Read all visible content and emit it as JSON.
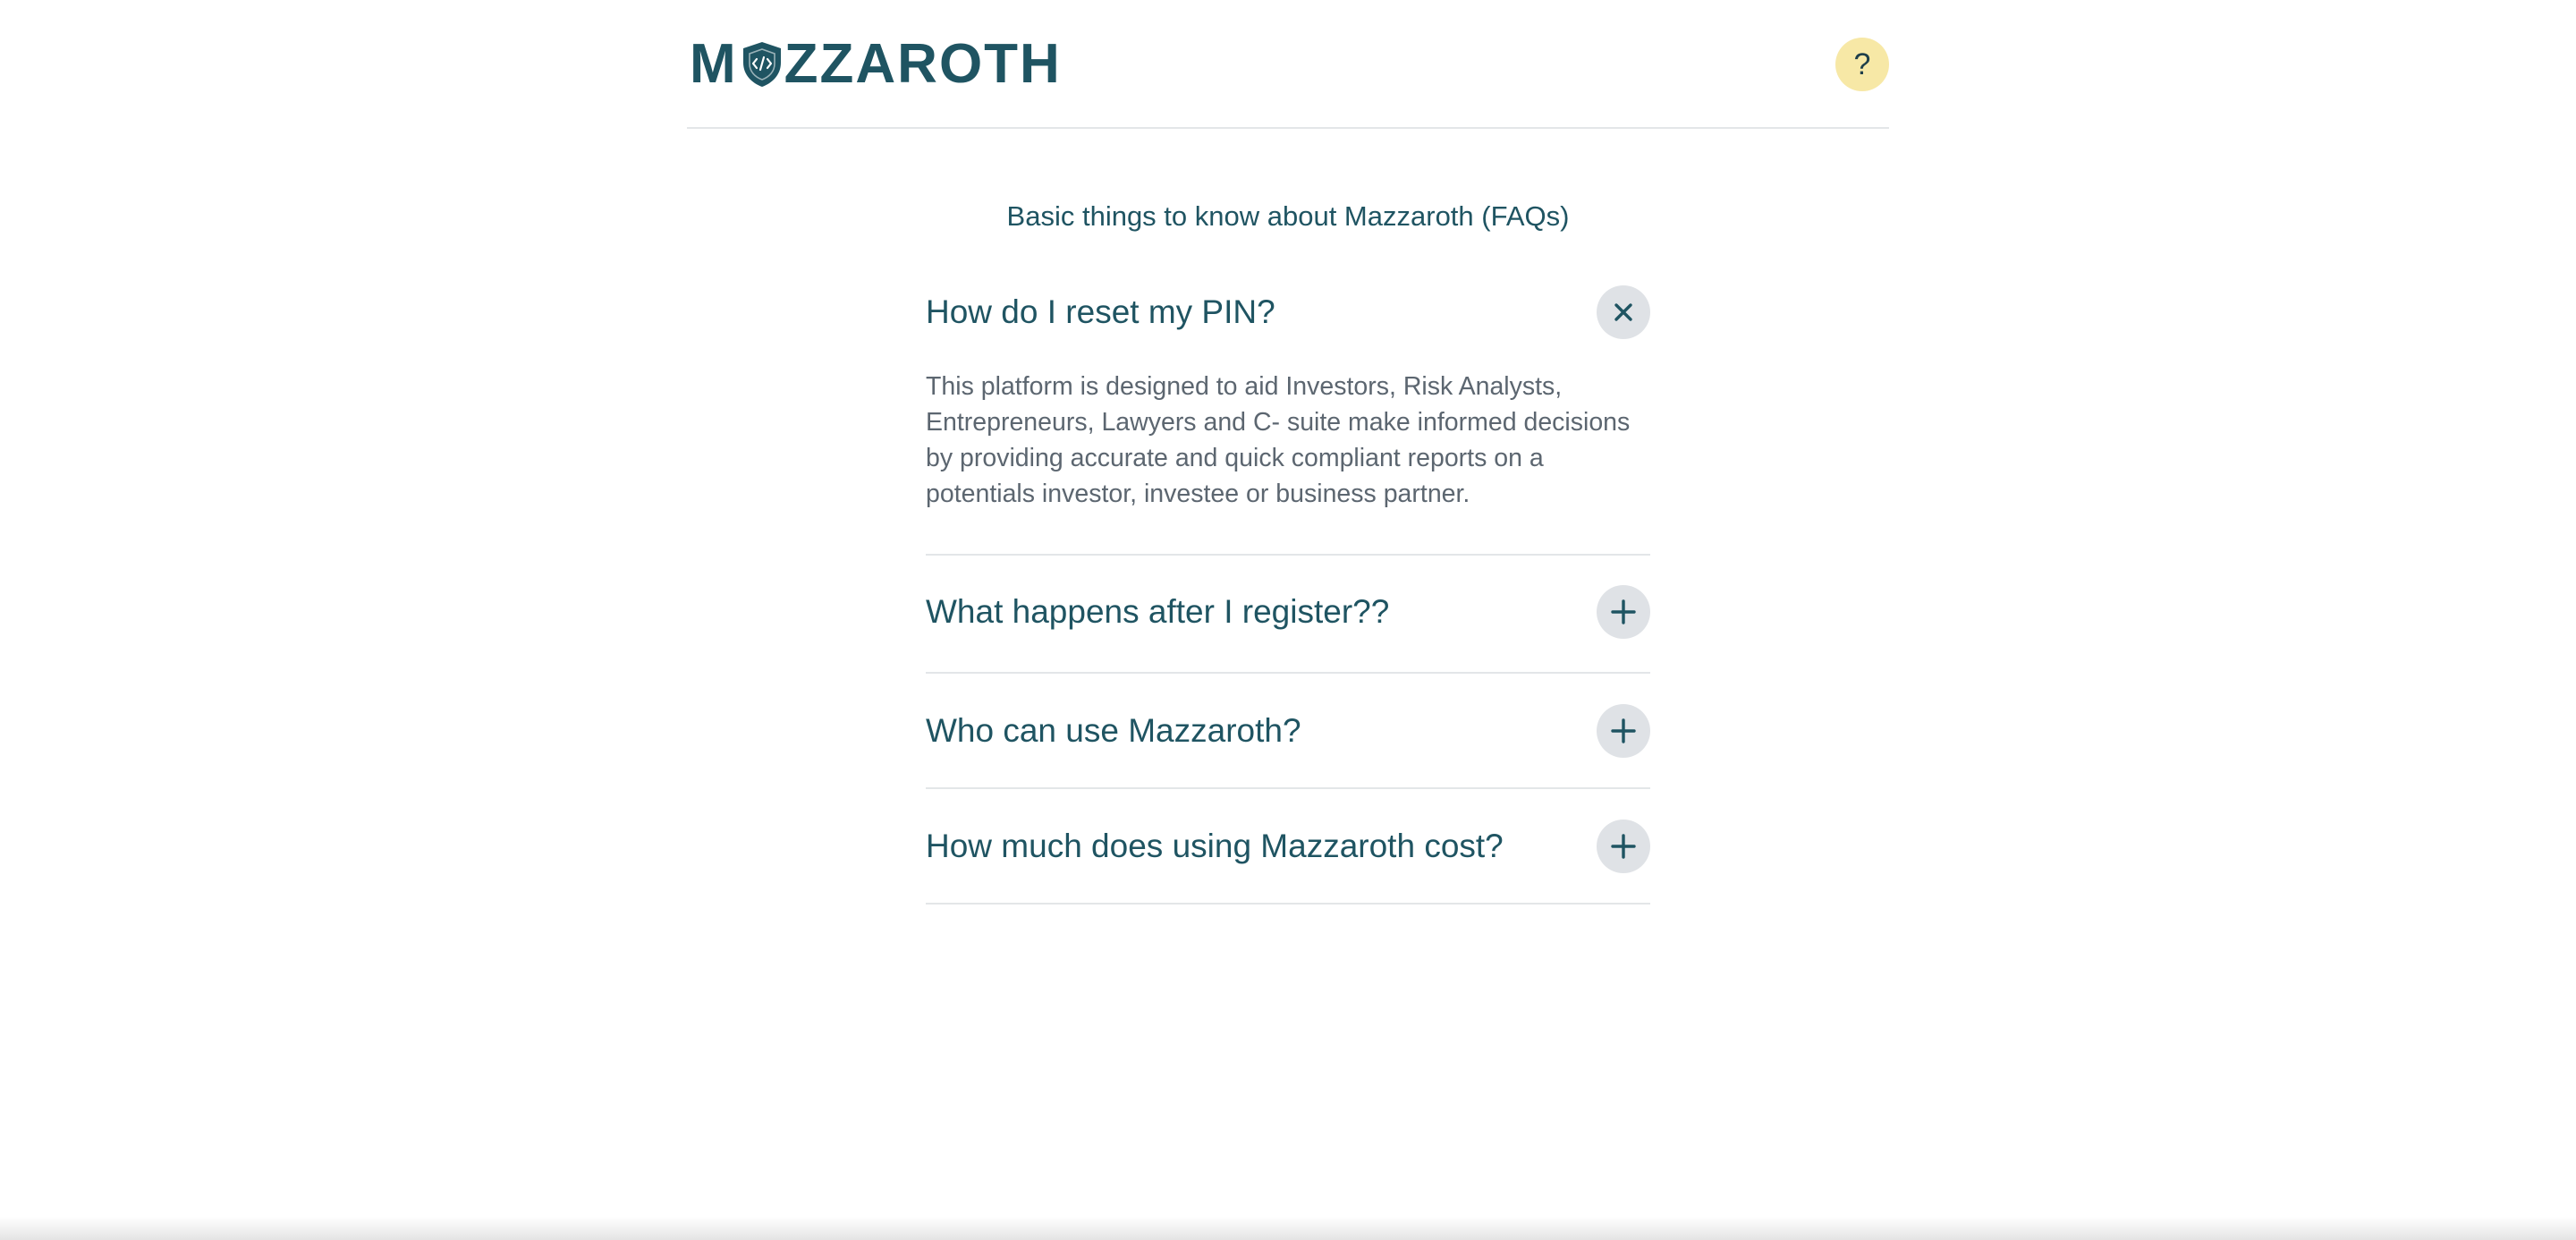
{
  "brand": {
    "name_prefix": "M",
    "name_suffix": "ZZAROTH",
    "logo_icon": "shield-code-icon",
    "color": "#1f5462"
  },
  "header": {
    "help_label": "?"
  },
  "faq": {
    "heading": "Basic things to know about Mazzaroth (FAQs)",
    "items": [
      {
        "question": "How do I reset my PIN?",
        "expanded": true,
        "toggle_icon": "close-icon",
        "answer": "This platform is designed to aid Investors, Risk Analysts, Entrepreneurs, Lawyers and C- suite make informed decisions by providing accurate and quick compliant reports on a potentials investor, investee or business partner."
      },
      {
        "question": "What happens after I register??",
        "expanded": false,
        "toggle_icon": "plus-icon"
      },
      {
        "question": "Who can use Mazzaroth?",
        "expanded": false,
        "toggle_icon": "plus-icon"
      },
      {
        "question": "How much does using Mazzaroth cost?",
        "expanded": false,
        "toggle_icon": "plus-icon"
      }
    ]
  },
  "colors": {
    "primary": "#1f5462",
    "help_bg": "#f7e8a6",
    "toggle_bg": "#dfe2e6",
    "divider": "#e3e6e8",
    "answer_text": "#5c6670"
  }
}
